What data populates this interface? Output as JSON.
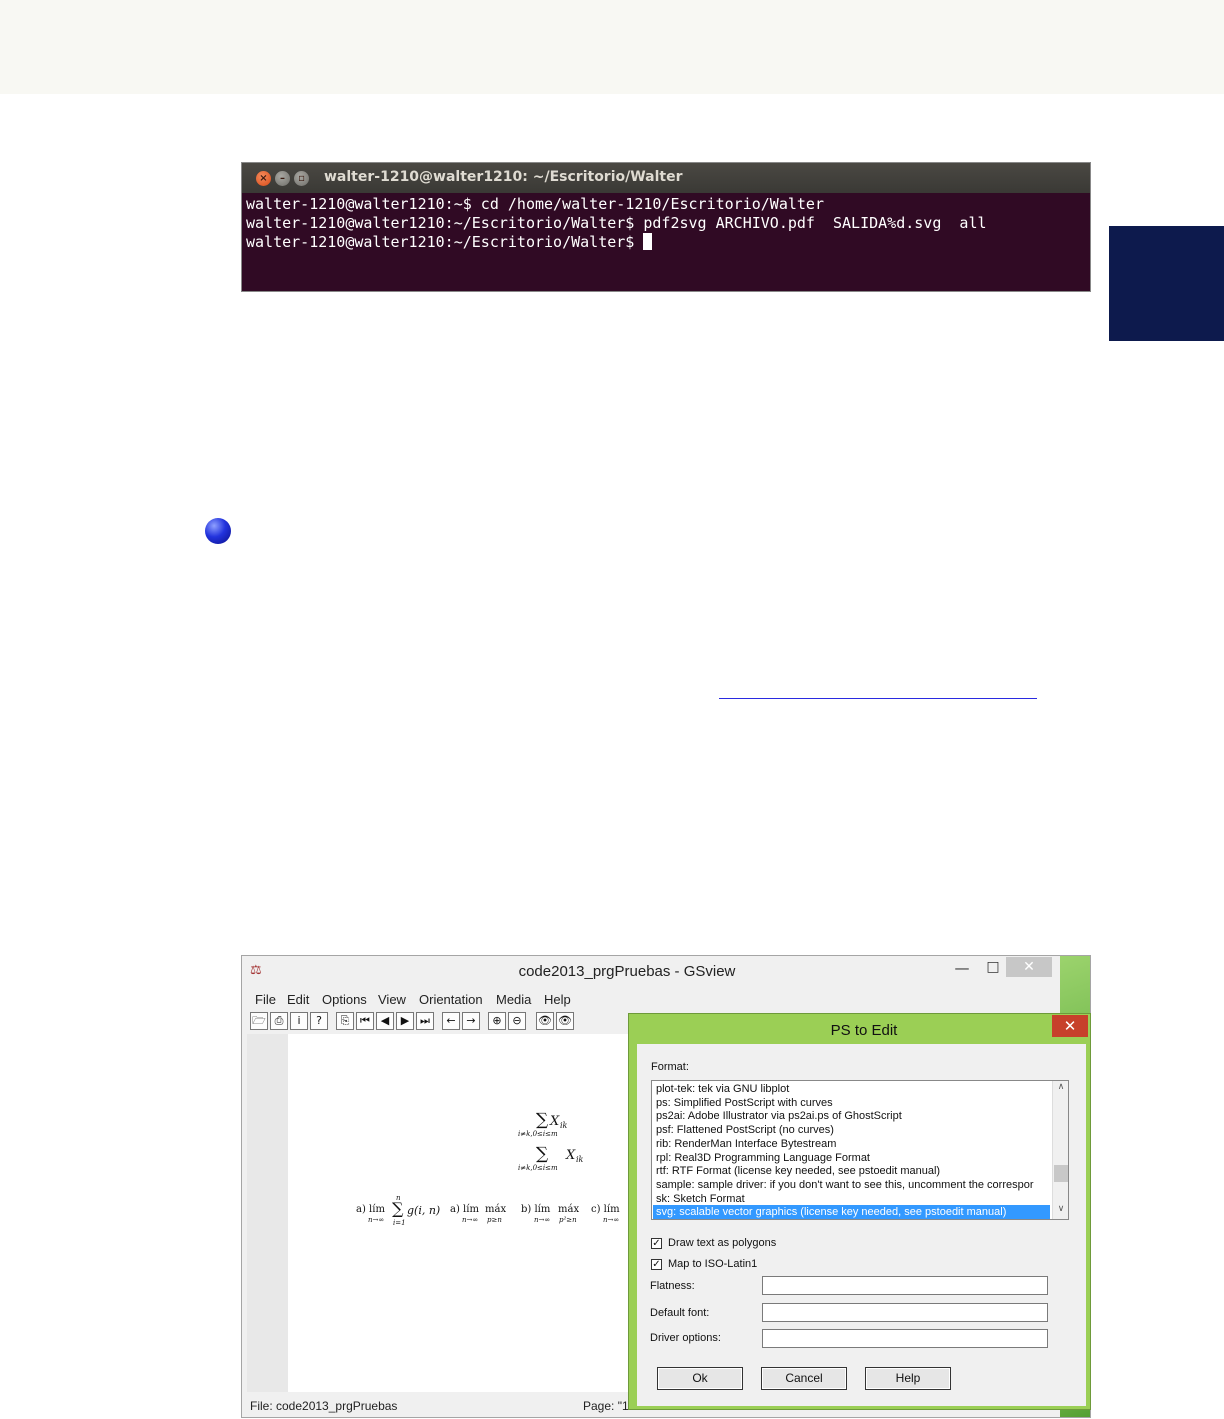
{
  "terminal": {
    "title": "walter-1210@walter1210: ~/Escritorio/Walter",
    "close_glyph": "×",
    "min_glyph": "–",
    "max_glyph": "▫",
    "line1": "walter-1210@walter1210:~$ cd /home/walter-1210/Escritorio/Walter",
    "line2": "walter-1210@walter1210:~/Escritorio/Walter$ pdf2svg ARCHIVO.pdf  SALIDA%d.svg  all",
    "line3": "walter-1210@walter1210:~/Escritorio/Walter$ "
  },
  "gsview": {
    "title": "code2013_prgPruebas - GSview",
    "menu": [
      "File",
      "Edit",
      "Options",
      "View",
      "Orientation",
      "Media",
      "Help"
    ],
    "toolbar_icons": [
      "open-icon",
      "print-icon",
      "info-icon",
      "help-icon",
      "goto-page-icon",
      "first-page-icon",
      "prev-page-icon",
      "next-page-icon",
      "last-page-icon",
      "back-icon",
      "forward-icon",
      "zoom-in-icon",
      "zoom-out-icon",
      "magnify-icon",
      "magnify-alt-icon"
    ],
    "toolbar_glyphs": [
      "🗁",
      "⎙",
      "i",
      "?",
      "⎘",
      "⏮",
      "◀",
      "▶",
      "⏭",
      "←",
      "→",
      "⊕",
      "⊖",
      "👁",
      "👁"
    ],
    "math": {
      "sum1": "∑",
      "sum1_var": "X",
      "sum1_sub": "ik",
      "sum1_below": "i≠k,0≤i≤m",
      "sum2": "∑",
      "sum2_var": "X",
      "sum2_sub": "ik",
      "sum2_below": "i≠k,0≤i≤m",
      "row_a1": "a) lím",
      "row_a1_below": "n→∞",
      "row_sum_top": "n",
      "row_sum": "∑",
      "row_sum_below": "i=1",
      "row_g": "g(i, n)",
      "row_a2": "a) lím",
      "row_a2_below": "n→∞",
      "row_max1": "máx",
      "row_max1_below": "p≥n",
      "row_b": "b) lím",
      "row_b_below": "n→∞",
      "row_max2": "máx",
      "row_max2_below": "p²≥n",
      "row_c": "c) lím",
      "row_c_below": "n→∞"
    },
    "status_file": "File: code2013_prgPruebas",
    "status_page": "Page: \"1"
  },
  "dialog": {
    "title": "PS to Edit",
    "format_label": "Format:",
    "formats": [
      "plot-tek:  tek  via GNU libplot",
      "ps:  Simplified PostScript with curves",
      "ps2ai:  Adobe Illustrator via ps2ai.ps of GhostScript",
      "psf:  Flattened PostScript (no curves)",
      "rib:  RenderMan Interface Bytestream",
      "rpl:  Real3D Programming Language Format",
      "rtf:  RTF Format (license key needed, see pstoedit manual)",
      "sample:  sample driver: if you don't want to see this, uncomment the correspor",
      "sk:  Sketch Format",
      "svg:  scalable vector graphics (license key needed, see pstoedit manual)"
    ],
    "selected_format_index": 9,
    "draw_text_label": "Draw text as polygons",
    "draw_text_checked": true,
    "map_latin_label": "Map to ISO-Latin1",
    "map_latin_checked": true,
    "check_glyph": "✓",
    "flatness_label": "Flatness:",
    "flatness_value": "",
    "default_font_label": "Default font:",
    "default_font_value": "",
    "driver_options_label": "Driver options:",
    "driver_options_value": "",
    "ok_label": "Ok",
    "cancel_label": "Cancel",
    "help_label": "Help"
  },
  "colors": {
    "terminal_bg": "#300a24",
    "side_tab": "#0d1a4d",
    "dialog_frame": "#9bcf55",
    "selection": "#3399ff"
  }
}
